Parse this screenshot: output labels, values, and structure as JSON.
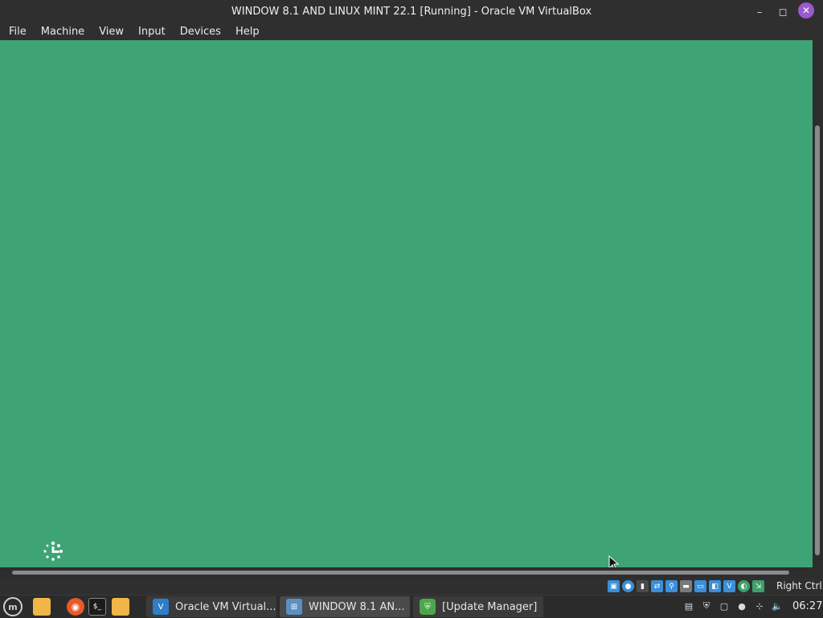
{
  "window": {
    "title": "WINDOW 8.1 AND LINUX MINT 22.1 [Running] - Oracle VM VirtualBox",
    "controls": {
      "minimize": "–",
      "maximize": "◻",
      "close": "✕"
    }
  },
  "menubar": {
    "items": [
      "File",
      "Machine",
      "View",
      "Input",
      "Devices",
      "Help"
    ]
  },
  "vm_screen": {
    "background_color": "#3fa475",
    "spinner_icon": "loading-spinner-icon",
    "cursor_icon": "mouse-pointer-icon"
  },
  "statusbar": {
    "icons": [
      "hard-disk-icon",
      "optical-drive-icon",
      "audio-icon",
      "network-icon",
      "usb-icon",
      "shared-folders-icon",
      "display-icon",
      "recording-icon",
      "virtualization-icon",
      "mouse-integration-icon",
      "keyboard-capture-icon"
    ],
    "host_key": "Right Ctrl"
  },
  "taskbar": {
    "launchers": [
      "mint-menu-icon",
      "folder-icon",
      "firefox-icon",
      "terminal-icon",
      "files-icon"
    ],
    "tasks": [
      {
        "label": "Oracle VM Virtual...",
        "icon": "virtualbox-icon"
      },
      {
        "label": "WINDOW 8.1 AN...",
        "icon": "vm-window-icon"
      },
      {
        "label": "[Update Manager]",
        "icon": "update-manager-shield-icon"
      }
    ],
    "tray": [
      "clipboard-icon",
      "shield-icon",
      "notes-icon",
      "user-icon",
      "network-icon",
      "volume-icon"
    ],
    "clock": "06:27"
  }
}
